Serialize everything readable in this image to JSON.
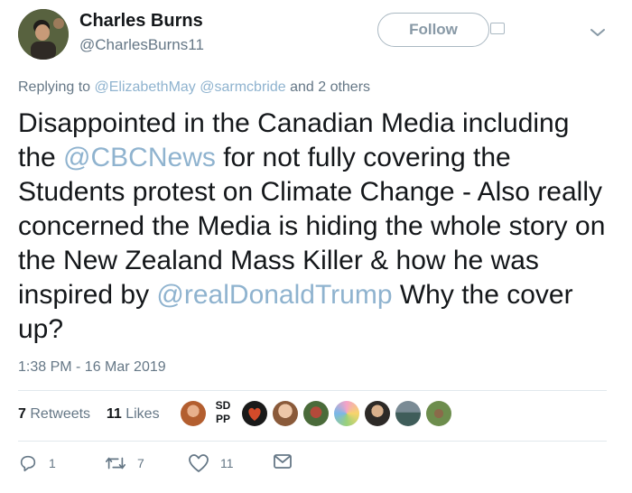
{
  "profile": {
    "name": "Charles Burns",
    "handle": "@CharlesBurns11",
    "avatar_icon": "avatar-photo"
  },
  "header": {
    "follow_label": "Follow",
    "menu_icon": "chevron-down-icon"
  },
  "reply": {
    "prefix": "Replying to",
    "mention1": "@ElizabethMay",
    "mention2": "@sarmcbride",
    "suffix": "and 2 others"
  },
  "tweet": {
    "part1": "Disappointed in the Canadian Media including the ",
    "mention1": "@CBCNews",
    "part2": " for not fully covering the Students protest on Climate Change - Also really concerned the Media is hiding the whole story on the New Zealand Mass Killer & how he was inspired by ",
    "mention2": "@realDonaldTrump",
    "part3": " Why the cover up?"
  },
  "timestamp": "1:38 PM - 16 Mar 2019",
  "stats": {
    "retweets_count": "7",
    "retweets_label": "Retweets",
    "likes_count": "11",
    "likes_label": "Likes",
    "liker_initials_top": "SD",
    "liker_initials_bottom": "PP"
  },
  "actions": {
    "reply_count": "1",
    "retweet_count": "7",
    "like_count": "11"
  },
  "colors": {
    "mention": "#8fb3cf",
    "secondary_text": "#657786",
    "primary_text": "#14171a"
  }
}
